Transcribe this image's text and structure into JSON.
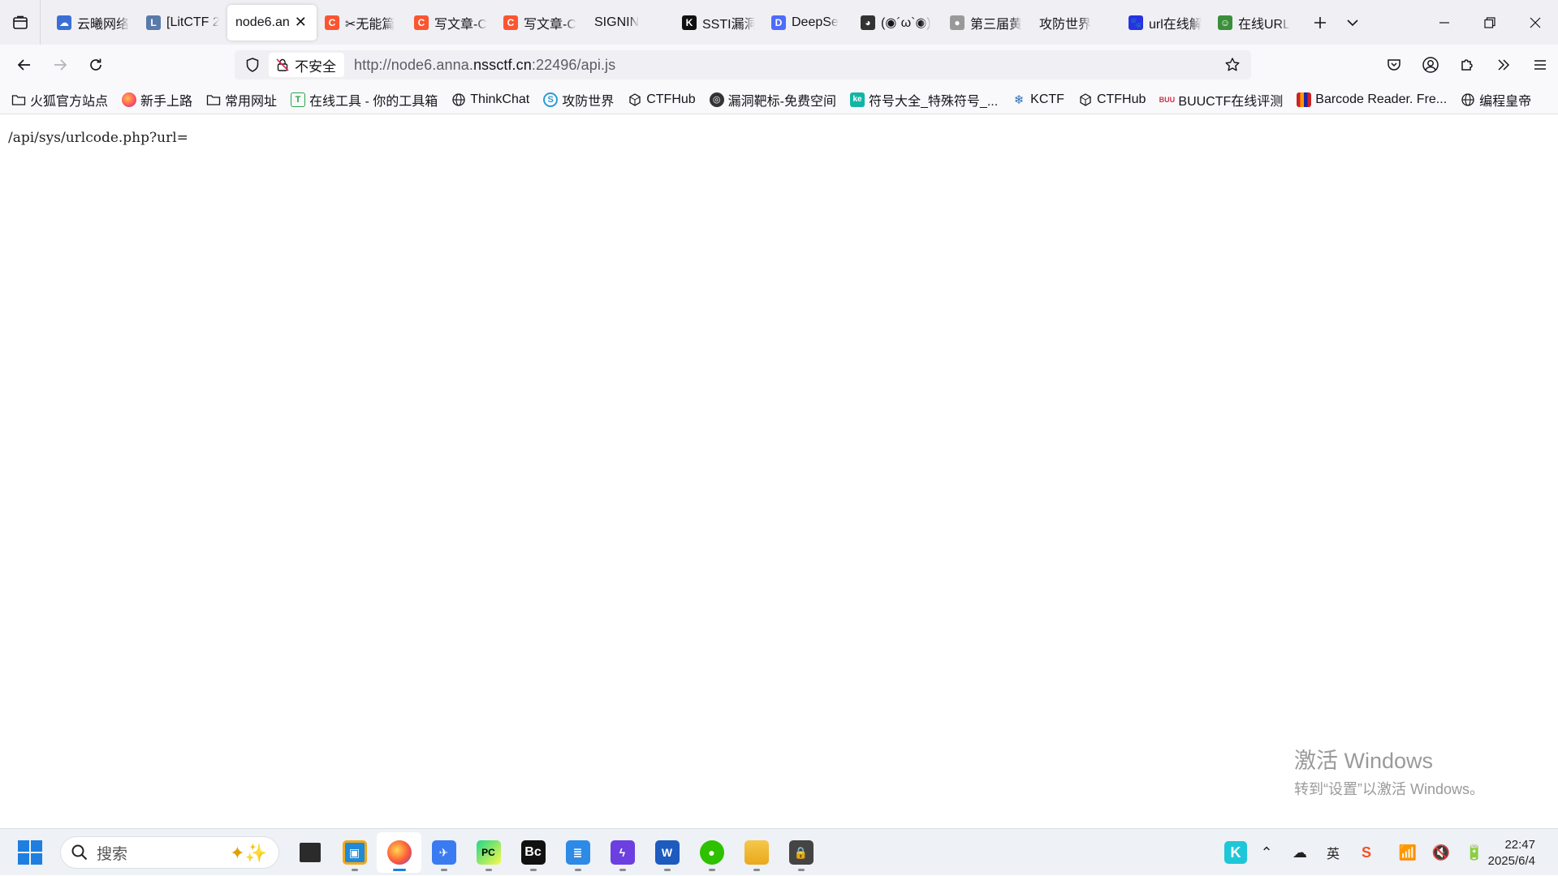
{
  "tabs": [
    {
      "label": "云曦网络",
      "favicon": "cloud-favicon",
      "color": "#3b6fd6"
    },
    {
      "label": "[LitCTF 2",
      "favicon": "litctf-favicon",
      "color": "#5a7aa8"
    },
    {
      "label": "node6.an",
      "favicon": "",
      "color": "",
      "active": true
    },
    {
      "label": "✂无能篇",
      "favicon": "csdn-favicon",
      "color": "#fc5531"
    },
    {
      "label": "写文章-C",
      "favicon": "csdn-favicon",
      "color": "#fc5531"
    },
    {
      "label": "写文章-C",
      "favicon": "csdn-favicon",
      "color": "#fc5531"
    },
    {
      "label": "SIGNIN",
      "favicon": "",
      "color": ""
    },
    {
      "label": "SSTI漏洞",
      "favicon": "k-favicon",
      "color": "#111111"
    },
    {
      "label": "DeepSe",
      "favicon": "deepseek-favicon",
      "color": "#4d6bfe"
    },
    {
      "label": "(◉´ω`◉)",
      "favicon": "avatar-favicon",
      "color": "#333333"
    },
    {
      "label": "第三届黄",
      "favicon": "mic-favicon",
      "color": "#777777"
    },
    {
      "label": "攻防世界",
      "favicon": "",
      "color": ""
    },
    {
      "label": "url在线解",
      "favicon": "baidu-favicon",
      "color": "#2932e1"
    },
    {
      "label": "在线URL",
      "favicon": "frog-favicon",
      "color": "#3a8f3a"
    }
  ],
  "toolbar": {
    "url_scheme": "http://node6.anna.",
    "url_host": "nssctf.cn",
    "url_rest": ":22496/api.js",
    "insecure_label": "不安全"
  },
  "bookmarks": [
    {
      "label": "火狐官方站点",
      "icon": "folder-icon"
    },
    {
      "label": "新手上路",
      "icon": "firefox-icon"
    },
    {
      "label": "常用网址",
      "icon": "folder-icon"
    },
    {
      "label": "在线工具 - 你的工具箱",
      "icon": "tool-icon"
    },
    {
      "label": "ThinkChat",
      "icon": "globe-icon"
    },
    {
      "label": "攻防世界",
      "icon": "adworld-icon"
    },
    {
      "label": "CTFHub",
      "icon": "cube-icon"
    },
    {
      "label": "漏洞靶标-免费空间",
      "icon": "target-icon"
    },
    {
      "label": "符号大全_特殊符号_...",
      "icon": "ke-icon"
    },
    {
      "label": "KCTF",
      "icon": "snow-icon"
    },
    {
      "label": "CTFHub",
      "icon": "cube-icon"
    },
    {
      "label": "BUUCTF在线评测",
      "icon": "buu-icon"
    },
    {
      "label": "Barcode Reader. Fre...",
      "icon": "barcode-icon"
    },
    {
      "label": "编程皇帝",
      "icon": "globe-icon"
    }
  ],
  "content": {
    "text": "/api/sys/urlcode.php?url="
  },
  "watermark": {
    "line1": "激活 Windows",
    "line2": "转到“设置”以激活 Windows。"
  },
  "taskbar": {
    "search_placeholder": "搜索",
    "time": "22:47",
    "date": "2025/6/4"
  }
}
